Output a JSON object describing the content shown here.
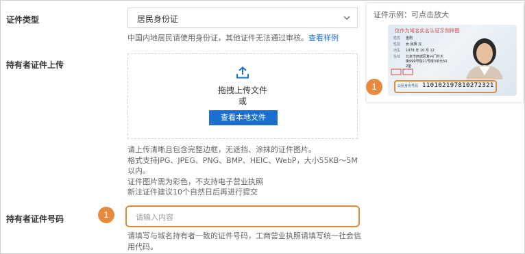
{
  "form": {
    "cert_type": {
      "label": "证件类型",
      "selected": "居民身份证",
      "hint_text": "中国内地居民请使用身份证，其他证件无法通过审核。",
      "hint_link": "查看样例"
    },
    "upload": {
      "label": "持有者证件上传",
      "drag_text": "拖拽上传文件",
      "or_text": "或",
      "button_label": "查看本地文件",
      "notes": [
        "请上传清晰且包含完整边框，无遮挡、涂抹的证件图片。",
        "格式支持JPG、JPEG、PNG、BMP、HEIC、WebP，大小55KB～5M",
        "以内。",
        "证件图片需为彩色，不支持电子营业执照",
        "新注证件建议10个自然日后再进行提交"
      ]
    },
    "cert_number": {
      "label": "持有者证件号码",
      "placeholder": "请输入内容",
      "value": "",
      "hints": [
        "请填写与域名持有者一致的证件号码，工商营业执照请填写统一社会信",
        "用代码。"
      ]
    }
  },
  "badges": {
    "left": "1",
    "right": "1",
    "color": "#e58a3e"
  },
  "sample": {
    "title": "证件示例：可点击放大",
    "card_title": "仅作为域名实名认证示例样图",
    "fields": [
      {
        "key": "姓名",
        "value": "金刚"
      },
      {
        "key": "性别",
        "value": "女   民族 汉"
      },
      {
        "key": "出生",
        "value": "1978  年  10  月  12"
      },
      {
        "key": "住址",
        "value": "北京市西城区复兴门外大"
      },
      {
        "key": "",
        "value": "街999号院11号楼3单元50"
      },
      {
        "key": "",
        "value": "2室"
      }
    ],
    "id_key": "公民身份号码",
    "id_value": "110102197810272321"
  },
  "colors": {
    "accent_blue": "#1a6fd0",
    "highlight_orange": "#e08a3c"
  }
}
